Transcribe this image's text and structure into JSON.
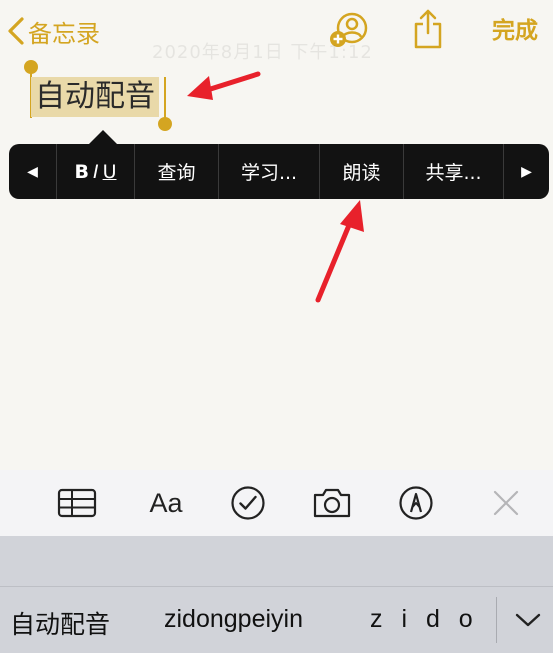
{
  "nav": {
    "back_label": "备忘录",
    "done_label": "完成",
    "date_text": "2020年8月1日 下午1:12"
  },
  "note": {
    "title": "自动配音"
  },
  "edit_menu": {
    "prev_arrow": "◀",
    "next_arrow": "▶",
    "bold": "B",
    "italic": "I",
    "underline": "U",
    "items": [
      "查询",
      "学习...",
      "朗读",
      "共享..."
    ]
  },
  "toolbar": {
    "text_style_label": "Aa"
  },
  "keyboard": {
    "candidates": [
      "自动配音",
      "zidongpeiyin",
      "z i d o"
    ]
  },
  "colors": {
    "accent": "#d4a521",
    "selection": "#e9d9a9",
    "menu_bg": "#121212",
    "annotation": "#e8212b"
  }
}
